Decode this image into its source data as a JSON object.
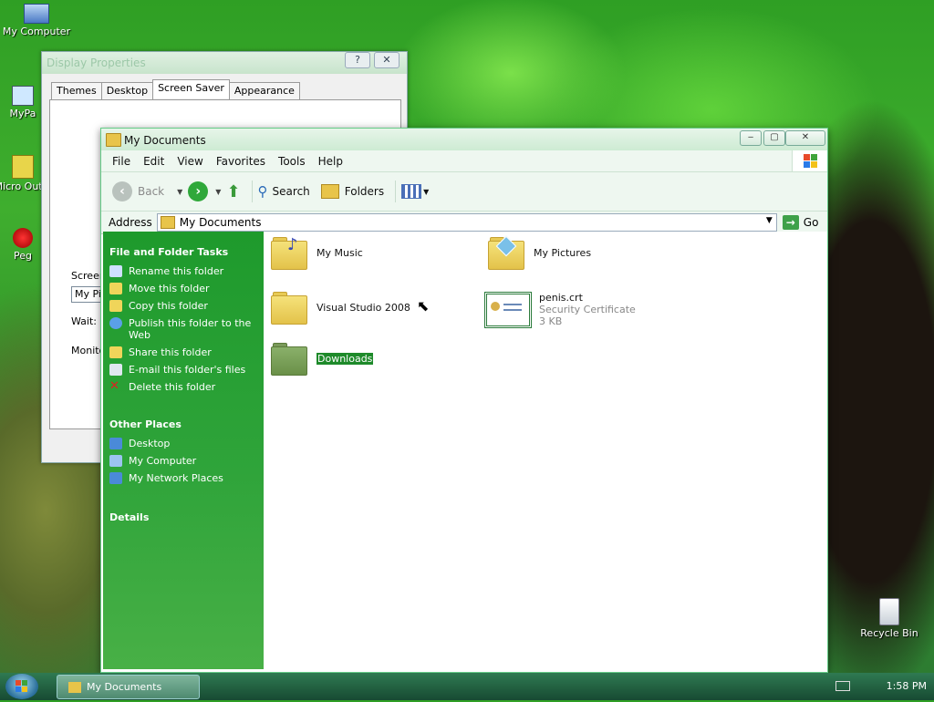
{
  "desktop": {
    "icons": [
      {
        "label": "My Computer",
        "icon": "computer-icon"
      },
      {
        "label": "MyPa",
        "icon": "shortcut-icon"
      },
      {
        "label": "Micro Outlo",
        "icon": "outlook-icon"
      },
      {
        "label": "Peg",
        "icon": "pegasus-icon"
      },
      {
        "label": "Recycle Bin",
        "icon": "recycle-bin-icon"
      }
    ]
  },
  "display_properties": {
    "title": "Display Properties",
    "help_btn": "?",
    "close_btn": "✕",
    "tabs": [
      "Themes",
      "Desktop",
      "Screen Saver",
      "Appearance"
    ],
    "active_tab": "Screen Saver",
    "screen_label": "Screen",
    "screen_value": "My Pic",
    "wait_label": "Wait:",
    "monitor_label": "Monito"
  },
  "explorer": {
    "title": "My Documents",
    "menu": [
      "File",
      "Edit",
      "View",
      "Favorites",
      "Tools",
      "Help"
    ],
    "toolbar": {
      "back": "Back",
      "search": "Search",
      "folders": "Folders"
    },
    "address": {
      "label": "Address",
      "value": "My Documents",
      "go": "Go"
    },
    "sidebar": {
      "tasks_header": "File and Folder Tasks",
      "tasks": [
        "Rename this folder",
        "Move this folder",
        "Copy this folder",
        "Publish this folder to the Web",
        "Share this folder",
        "E-mail this folder's files",
        "Delete this folder"
      ],
      "other_header": "Other Places",
      "other": [
        "Desktop",
        "My Computer",
        "My Network Places"
      ],
      "details_header": "Details"
    },
    "items": [
      {
        "name": "My Music"
      },
      {
        "name": "My Pictures"
      },
      {
        "name": "Visual Studio 2008"
      },
      {
        "name": "penis.crt",
        "type": "Security Certificate",
        "size": "3 KB"
      },
      {
        "name": "Downloads"
      }
    ]
  },
  "taskbar": {
    "window_button": "My Documents",
    "clock": "1:58 PM"
  }
}
